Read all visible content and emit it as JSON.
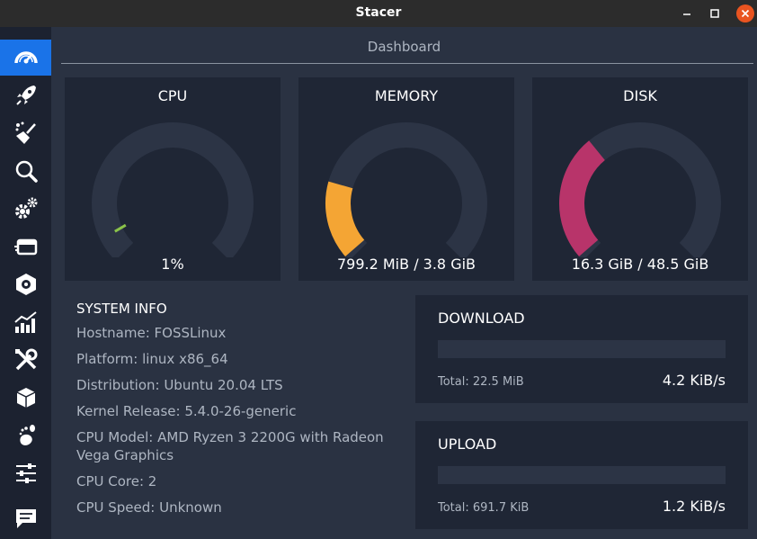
{
  "window": {
    "title": "Stacer"
  },
  "sidebar": {
    "items": [
      {
        "icon": "speedometer-icon",
        "active": true
      },
      {
        "icon": "rocket-icon"
      },
      {
        "icon": "broom-icon"
      },
      {
        "icon": "search-icon"
      },
      {
        "icon": "gears-icon"
      },
      {
        "icon": "services-icon"
      },
      {
        "icon": "uninstaller-icon"
      },
      {
        "icon": "resources-chart-icon"
      },
      {
        "icon": "tools-icon"
      },
      {
        "icon": "package-icon"
      },
      {
        "icon": "gnome-icon"
      },
      {
        "icon": "sliders-icon"
      },
      {
        "icon": "chat-icon"
      }
    ]
  },
  "dashboard": {
    "title": "Dashboard",
    "gauges": [
      {
        "label": "CPU",
        "value_text": "1%",
        "percent": 1,
        "color": "#8bc34a"
      },
      {
        "label": "MEMORY",
        "value_text": "799.2 MiB / 3.8 GiB",
        "percent": 21,
        "color": "#f4a534"
      },
      {
        "label": "DISK",
        "value_text": "16.3 GiB / 48.5 GiB",
        "percent": 34,
        "color": "#b8346a"
      }
    ],
    "system_info": {
      "title": "SYSTEM INFO",
      "rows": [
        "Hostname: FOSSLinux",
        "Platform: linux x86_64",
        "Distribution: Ubuntu 20.04 LTS",
        "Kernel Release: 5.4.0-26-generic",
        "CPU Model:  AMD Ryzen 3 2200G with Radeon Vega Graphics",
        "CPU Core: 2",
        "CPU Speed: Unknown"
      ]
    },
    "download": {
      "title": "DOWNLOAD",
      "total": "Total: 22.5 MiB",
      "speed": "4.2 KiB/s"
    },
    "upload": {
      "title": "UPLOAD",
      "total": "Total: 691.7 KiB",
      "speed": "1.2 KiB/s"
    }
  },
  "colors": {
    "background": "#2a3242",
    "card": "#1f2635",
    "sidebar": "#1c2230",
    "active": "#1a73e8",
    "gauge_track": "#2c3445",
    "close_button": "#e95420"
  }
}
